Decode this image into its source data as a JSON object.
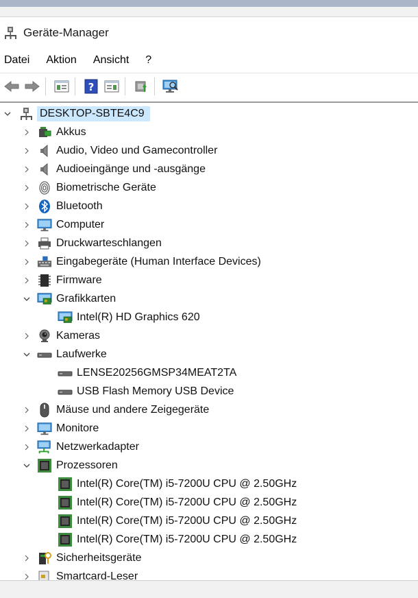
{
  "window": {
    "title": "Geräte-Manager"
  },
  "menu": [
    "Datei",
    "Aktion",
    "Ansicht",
    "?"
  ],
  "tree": {
    "root": "DESKTOP-SBTE4C9",
    "items": [
      {
        "label": "Akkus",
        "level": 1,
        "expanded": false,
        "icon": "battery-icon"
      },
      {
        "label": "Audio, Video und Gamecontroller",
        "level": 1,
        "expanded": false,
        "icon": "speaker-icon"
      },
      {
        "label": "Audioeingänge und -ausgänge",
        "level": 1,
        "expanded": false,
        "icon": "speaker-icon"
      },
      {
        "label": "Biometrische Geräte",
        "level": 1,
        "expanded": false,
        "icon": "fingerprint-icon"
      },
      {
        "label": "Bluetooth",
        "level": 1,
        "expanded": false,
        "icon": "bluetooth-icon"
      },
      {
        "label": "Computer",
        "level": 1,
        "expanded": false,
        "icon": "monitor-icon"
      },
      {
        "label": "Druckwarteschlangen",
        "level": 1,
        "expanded": false,
        "icon": "printer-icon"
      },
      {
        "label": "Eingabegeräte (Human Interface Devices)",
        "level": 1,
        "expanded": false,
        "icon": "hid-icon"
      },
      {
        "label": "Firmware",
        "level": 1,
        "expanded": false,
        "icon": "chip-icon"
      },
      {
        "label": "Grafikkarten",
        "level": 1,
        "expanded": true,
        "icon": "display-adapter-icon"
      },
      {
        "label": "Intel(R) HD Graphics 620",
        "level": 2,
        "icon": "display-adapter-icon"
      },
      {
        "label": "Kameras",
        "level": 1,
        "expanded": false,
        "icon": "camera-icon"
      },
      {
        "label": "Laufwerke",
        "level": 1,
        "expanded": true,
        "icon": "drive-icon"
      },
      {
        "label": "LENSE20256GMSP34MEAT2TA",
        "level": 2,
        "icon": "drive-icon"
      },
      {
        "label": "USB Flash Memory USB Device",
        "level": 2,
        "icon": "drive-icon"
      },
      {
        "label": "Mäuse und andere Zeigegeräte",
        "level": 1,
        "expanded": false,
        "icon": "mouse-icon"
      },
      {
        "label": "Monitore",
        "level": 1,
        "expanded": false,
        "icon": "monitor-icon"
      },
      {
        "label": "Netzwerkadapter",
        "level": 1,
        "expanded": false,
        "icon": "network-icon"
      },
      {
        "label": "Prozessoren",
        "level": 1,
        "expanded": true,
        "icon": "processor-icon"
      },
      {
        "label": "Intel(R) Core(TM) i5-7200U CPU @ 2.50GHz",
        "level": 2,
        "icon": "processor-icon"
      },
      {
        "label": "Intel(R) Core(TM) i5-7200U CPU @ 2.50GHz",
        "level": 2,
        "icon": "processor-icon"
      },
      {
        "label": "Intel(R) Core(TM) i5-7200U CPU @ 2.50GHz",
        "level": 2,
        "icon": "processor-icon"
      },
      {
        "label": "Intel(R) Core(TM) i5-7200U CPU @ 2.50GHz",
        "level": 2,
        "icon": "processor-icon"
      },
      {
        "label": "Sicherheitsgeräte",
        "level": 1,
        "expanded": false,
        "icon": "security-device-icon"
      },
      {
        "label": "Smartcard-Leser",
        "level": 1,
        "expanded": false,
        "icon": "smartcard-icon"
      }
    ]
  }
}
